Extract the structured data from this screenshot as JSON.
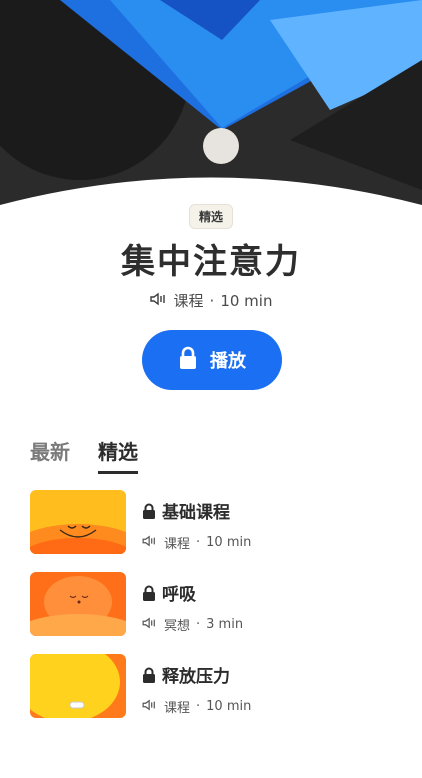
{
  "hero": {
    "colors": {
      "blue": "#2a8df0",
      "dark": "#2a2a2a",
      "light_blue": "#5fb3ff"
    }
  },
  "badge": {
    "label": "精选"
  },
  "course": {
    "title": "集中注意力",
    "meta_type": "课程",
    "meta_sep": "·",
    "meta_duration": "10 min"
  },
  "play_button": {
    "label": "播放",
    "icon": "lock-icon",
    "color": "#1a6ff2"
  },
  "tabs": [
    {
      "label": "最新",
      "active": false
    },
    {
      "label": "精选",
      "active": true
    }
  ],
  "items": [
    {
      "title": "基础课程",
      "type": "课程",
      "sep": "·",
      "duration": "10 min",
      "icon": "lock-icon",
      "thumb": "smiling-sun"
    },
    {
      "title": "呼吸",
      "type": "冥想",
      "sep": "·",
      "duration": "3 min",
      "icon": "lock-icon",
      "thumb": "calm-sun"
    },
    {
      "title": "释放压力",
      "type": "课程",
      "sep": "·",
      "duration": "10 min",
      "icon": "lock-icon",
      "thumb": "yellow-sun"
    }
  ],
  "speaker_icon_name": "speaker-icon"
}
